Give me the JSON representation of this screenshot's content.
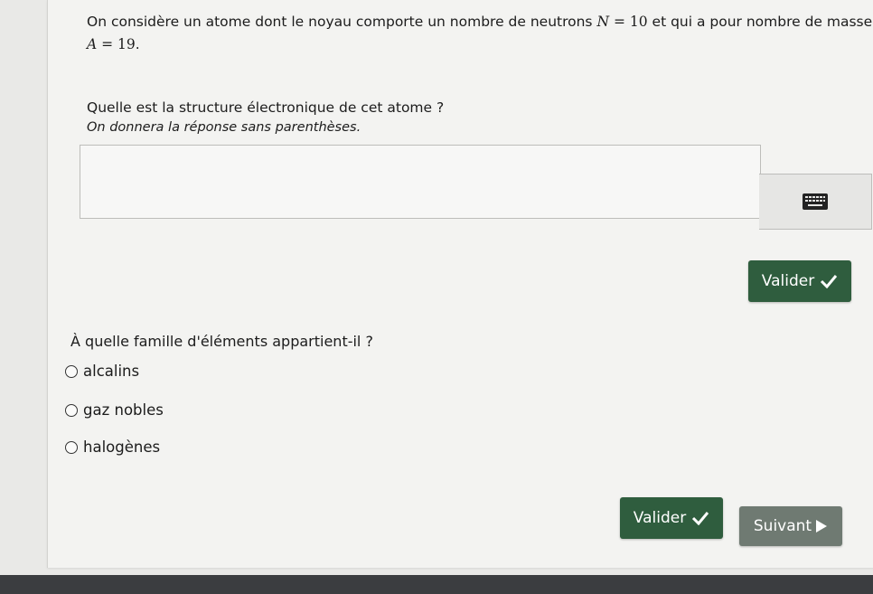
{
  "question1": {
    "line1_prefix": "On considère un atome dont le noyau comporte un nombre de neutrons",
    "n_symbol": "N",
    "n_equals": " = ",
    "n_value": "10",
    "line1_suffix": "et qui a pour nombre de masse",
    "a_symbol": "A",
    "a_equals": " = ",
    "a_value": "19",
    "a_period": ".",
    "prompt": "Quelle est la structure électronique de cet atome ?",
    "hint": "On donnera la réponse sans parenthèses.",
    "answer_value": "",
    "validate_label": "Valider"
  },
  "question2": {
    "prompt": "À quelle famille d'éléments appartient-il ?",
    "options": [
      "alcalins",
      "gaz nobles",
      "halogènes"
    ],
    "validate_label": "Valider",
    "next_label": "Suivant"
  },
  "colors": {
    "green_button": "#2f5d3e",
    "grey_button": "#6f7a72",
    "page_background": "#f3f3f1"
  },
  "icons": [
    "keyboard-icon",
    "check-icon",
    "play-triangle-icon"
  ]
}
